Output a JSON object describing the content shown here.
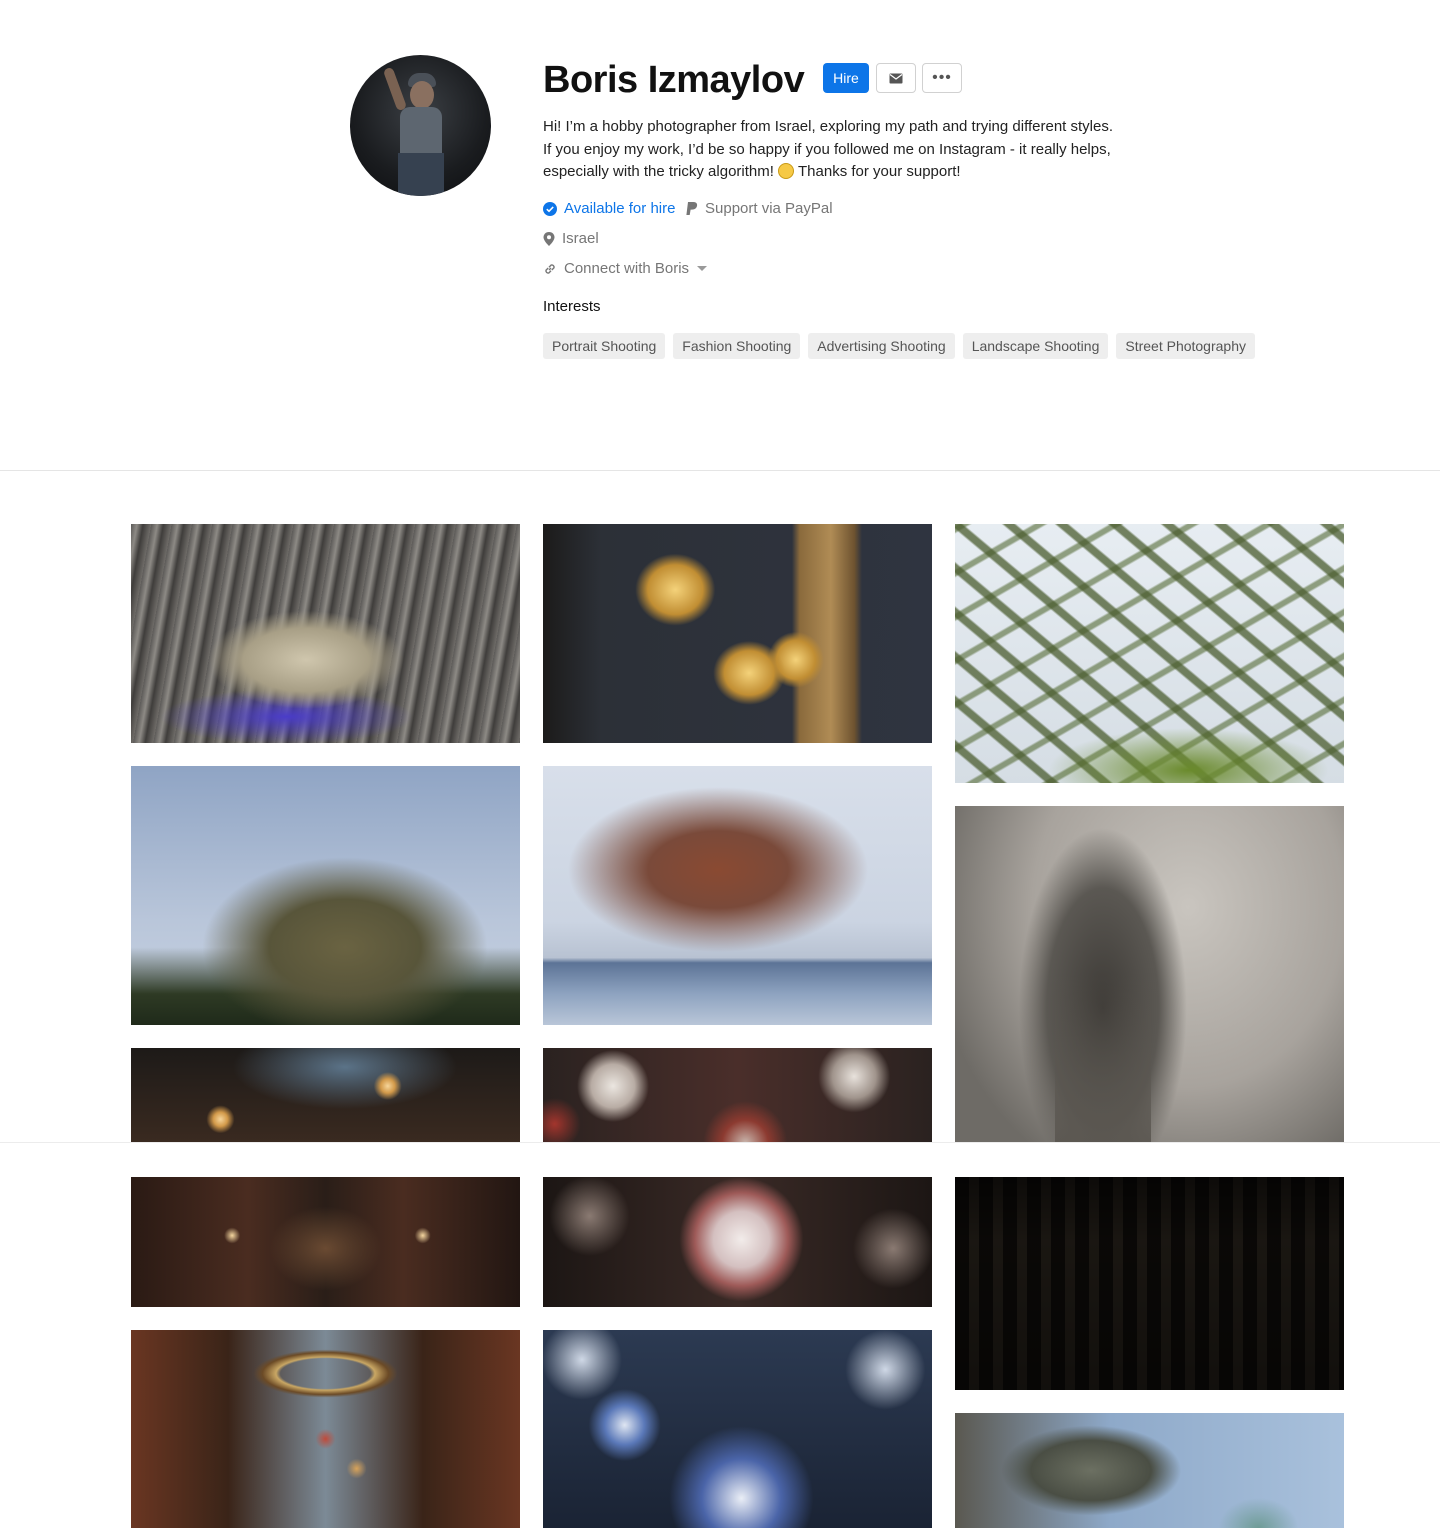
{
  "profile": {
    "name": "Boris Izmaylov",
    "hire_label": "Hire",
    "bio_part1": "Hi! I’m a hobby photographer from Israel, exploring my path and trying different styles. If you enjoy my work, I’d be so happy if you followed me on Instagram - it really helps, especially with the tricky algorithm!",
    "bio_part2": "Thanks for your support!",
    "available_label": "Available for hire",
    "paypal_label": "Support via PayPal",
    "location": "Israel",
    "connect_label": "Connect with Boris",
    "interests_title": "Interests",
    "interests": [
      "Portrait Shooting",
      "Fashion Shooting",
      "Advertising Shooting",
      "Landscape Shooting",
      "Street Photography"
    ]
  },
  "colors": {
    "accent": "#0d75e8",
    "tag_bg": "#eeeeee",
    "muted_text": "#767676"
  },
  "photos": [
    {
      "name": "photo-vw-beetle"
    },
    {
      "name": "photo-lamp-shades"
    },
    {
      "name": "photo-mossy-tree"
    },
    {
      "name": "photo-willow-tree"
    },
    {
      "name": "photo-willow-lake"
    },
    {
      "name": "photo-foggy-spire"
    },
    {
      "name": "photo-arcade-lights"
    },
    {
      "name": "photo-ornaments-red"
    },
    {
      "name": "photo-arcade-corridor"
    },
    {
      "name": "photo-snow-globe-ornament"
    },
    {
      "name": "photo-old-building"
    },
    {
      "name": "photo-arcade-wreath"
    },
    {
      "name": "photo-blue-ornaments"
    },
    {
      "name": "photo-gargoyle-statue"
    }
  ]
}
